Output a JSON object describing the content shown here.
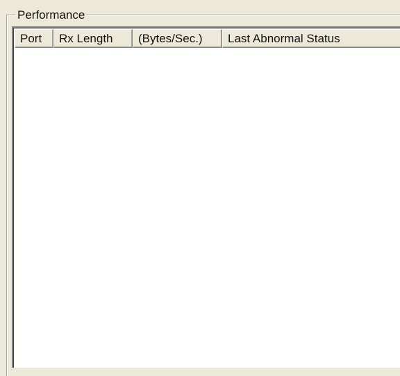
{
  "performance": {
    "title": "Performance",
    "columns": [
      {
        "label": "Port"
      },
      {
        "label": "Rx Length"
      },
      {
        "label": "(Bytes/Sec.)"
      },
      {
        "label": "Last Abnormal Status"
      }
    ],
    "rows": []
  }
}
